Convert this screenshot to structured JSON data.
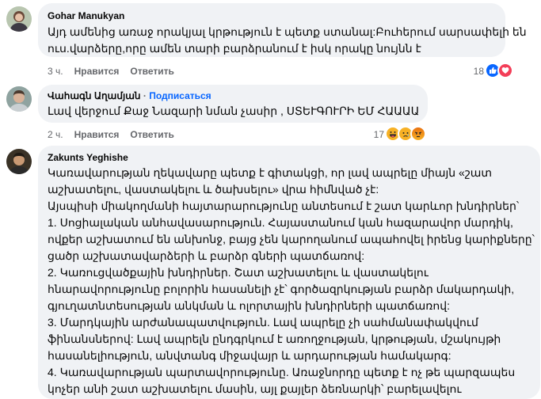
{
  "comments": [
    {
      "author": "Gohar Manukyan",
      "lines": [
        "Այդ ամենից առաջ որակյալ կրթություն է պետք ստանալ:Բուհերում սարսափելի են",
        "ուս.վարձերը,որը ամեն տարի բարձրանում է իսկ որակը նույնն է"
      ],
      "time": "3 ч.",
      "like_label": "Нравится",
      "reply_label": "Ответить",
      "reaction_count": "18",
      "reactions": [
        "like-icon",
        "love-icon"
      ]
    },
    {
      "author": "Վահագն Աղամյան",
      "separator": "·",
      "follow_label": "Подписаться",
      "lines": [
        "Լավ վերջում Քաջ Նազարի նման չասիր , ՍՏԵՒԳՈՒՐԻ ԵՄ ՀԱԱԱԱ"
      ],
      "time": "2 ч.",
      "like_label": "Нравится",
      "reply_label": "Ответить",
      "reaction_count": "17",
      "reactions": [
        "haha-icon",
        "sad-icon",
        "angry-icon"
      ]
    },
    {
      "author": "Zakunts Yeghishe",
      "lines": [
        "Կառավարության ղեկավարը պետք է գիտակցի, որ լավ ապրելը միայն «շատ",
        "աշխատելու, վաստակելու և ծախսելու» վրա հիմնված չէ:",
        "Այսպիսի միակողմանի հայտարարությունը անտեսում է շատ կարևոր խնդիրներ՝",
        "1. Սոցիալական անհավասարություն. Հայաստանում կան հազարավոր մարդիկ,",
        "ովքեր աշխատում են անխոնջ, բայց չեն կարողանում ապահովել իրենց կարիքները՝",
        "ցածր աշխատավարձերի և բարձր գների պատճառով:",
        "2. Կառուցվածքային խնդիրներ. Շատ աշխատելու և վաստակելու",
        "հնարավորությունը բոլորին հասանելի չէ՝ գործազրկության բարձր մակարդակի,",
        "գյուղատնտեսության անկման և ոլորտային խնդիրների պատճառով:",
        "3. Մարդկային արժանապատվություն. Լավ ապրելը չի սահմանափակվում",
        "ֆինանսներով: Լավ ապրելն ընդգրկում է առողջության, կրթության, մշակույթի",
        "հասանելիություն, անվտանգ միջավայր և արդարության համակարգ:",
        "4. Կառավարության պարտավորությունը. Առաջնորդը պետք է ոչ թե պարզապես",
        "կոչեր անի շատ աշխատելու մասին, այլ քայլեր ձեռնարկի՝ բարելավելու"
      ]
    }
  ],
  "colors": {
    "bubble_bg": "#f0f2f5",
    "meta_text": "#65676b",
    "link_blue": "#0866ff",
    "like_blue": "#0866ff",
    "love_red": "#f33e58",
    "haha_yellow": "#f7b125",
    "angry_orange": "#e9710f"
  }
}
